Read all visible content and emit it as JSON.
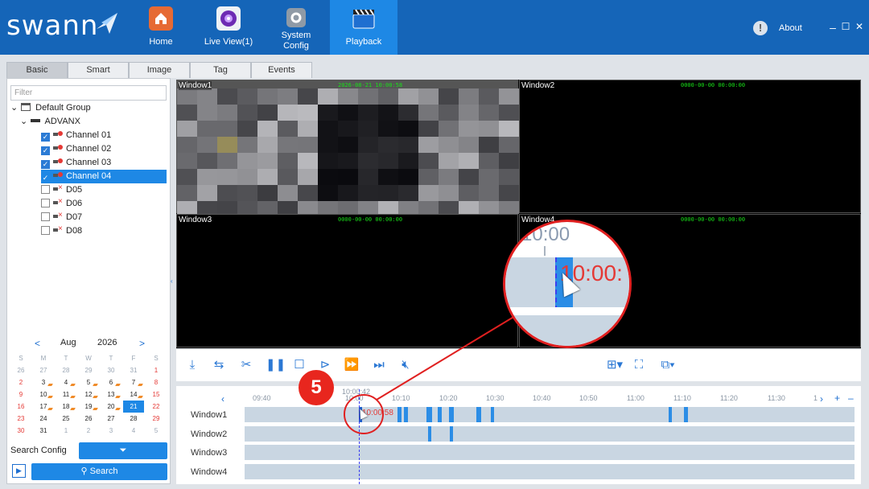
{
  "app": {
    "logo": "swann",
    "nav": [
      {
        "label": "Home",
        "icon": "home-icon"
      },
      {
        "label": "Live View(1)",
        "icon": "live-view-icon"
      },
      {
        "label": "System\nConfig",
        "icon": "system-config-icon"
      },
      {
        "label": "Playback",
        "icon": "playback-icon"
      }
    ],
    "about_label": "About",
    "window_controls": [
      "–",
      "☐",
      "✕"
    ]
  },
  "tabs": [
    "Basic",
    "Smart",
    "Image",
    "Tag",
    "Events"
  ],
  "left_panel": {
    "filter_placeholder": "Filter",
    "tree": {
      "group": "Default Group",
      "device": "ADVANX",
      "channels": [
        {
          "label": "Channel 01",
          "checked": true,
          "online": true
        },
        {
          "label": "Channel 02",
          "checked": true,
          "online": true
        },
        {
          "label": "Channel 03",
          "checked": true,
          "online": true
        },
        {
          "label": "Channel 04",
          "checked": true,
          "online": true,
          "selected": true
        },
        {
          "label": "D05",
          "checked": false,
          "online": false
        },
        {
          "label": "D06",
          "checked": false,
          "online": false
        },
        {
          "label": "D07",
          "checked": false,
          "online": false
        },
        {
          "label": "D08",
          "checked": false,
          "online": false
        }
      ]
    },
    "calendar": {
      "prev": "<",
      "next": ">",
      "month": "Aug",
      "year": "2026",
      "weekdays": [
        "S",
        "M",
        "T",
        "W",
        "T",
        "F",
        "S"
      ],
      "weeks": [
        [
          "26",
          "27",
          "28",
          "29",
          "30",
          "31",
          "1"
        ],
        [
          "2",
          "3",
          "4",
          "5",
          "6",
          "7",
          "8"
        ],
        [
          "9",
          "10",
          "11",
          "12",
          "13",
          "14",
          "15"
        ],
        [
          "16",
          "17",
          "18",
          "19",
          "20",
          "21",
          "22"
        ],
        [
          "23",
          "24",
          "25",
          "26",
          "27",
          "28",
          "29"
        ],
        [
          "30",
          "31",
          "1",
          "2",
          "3",
          "4",
          "5"
        ]
      ],
      "selected_day": "21"
    },
    "search_config_label": "Search Config",
    "search_label": "Search"
  },
  "video": {
    "windows": [
      {
        "title": "Window1",
        "timestamp": "2026-08-21 10:00:58"
      },
      {
        "title": "Window2",
        "timestamp": "0000-00-00 00:00:00"
      },
      {
        "title": "Window3",
        "timestamp": "0000-00-00 00:00:00"
      },
      {
        "title": "Window4",
        "timestamp": "0000-00-00 00:00:00"
      }
    ]
  },
  "timeline": {
    "hover_time": "10:00:42",
    "cursor_label": "10:00:58",
    "ticks": [
      "09:40",
      "10:00",
      "10:10",
      "10:20",
      "10:30",
      "10:40",
      "10:50",
      "11:00",
      "11:10",
      "11:20",
      "11:30",
      "1"
    ],
    "rows": [
      "Window1",
      "Window2",
      "Window3",
      "Window4"
    ],
    "zoom_plus": "+",
    "zoom_minus": "–"
  },
  "callout": {
    "step_number": "5",
    "zoom_tick": "10:00",
    "zoom_label": "10:00:"
  },
  "colors": {
    "header": "#1565b8",
    "active_nav": "#1e88e5",
    "accent": "#1e88e5",
    "record_segment": "#2b8de6",
    "timestamp": "#18e018",
    "callout": "#e02020"
  }
}
